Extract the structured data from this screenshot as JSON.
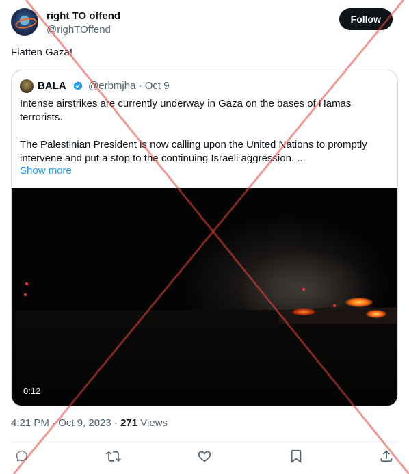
{
  "author": {
    "display_name": "right TO offend",
    "handle": "@righTOffend",
    "avatar_icon": "planet-avatar"
  },
  "follow_label": "Follow",
  "tweet_text": "Flatten Gaza!",
  "quoted": {
    "display_name": "BALA",
    "handle_and_date": "@erbmjha · Oct 9",
    "verified_icon": "verified-badge-icon",
    "paragraph1": "Intense airstrikes are currently underway in Gaza on the bases of Hamas terrorists.",
    "paragraph2": "The Palestinian President is now calling upon the United Nations to promptly intervene and put a stop to the continuing Israeli aggression. ...",
    "show_more": "Show more",
    "video": {
      "duration": "0:12"
    }
  },
  "meta": {
    "time_date": "4:21 PM · Oct 9, 2023 · ",
    "views_count": "271",
    "views_label": "Views"
  },
  "actions": [
    "reply-icon",
    "retweet-icon",
    "like-icon",
    "bookmark-icon",
    "share-icon"
  ],
  "colors": {
    "accent": "#1d9bf0",
    "overlay_x": "#e8433a",
    "follow_bg": "#0f1419"
  }
}
